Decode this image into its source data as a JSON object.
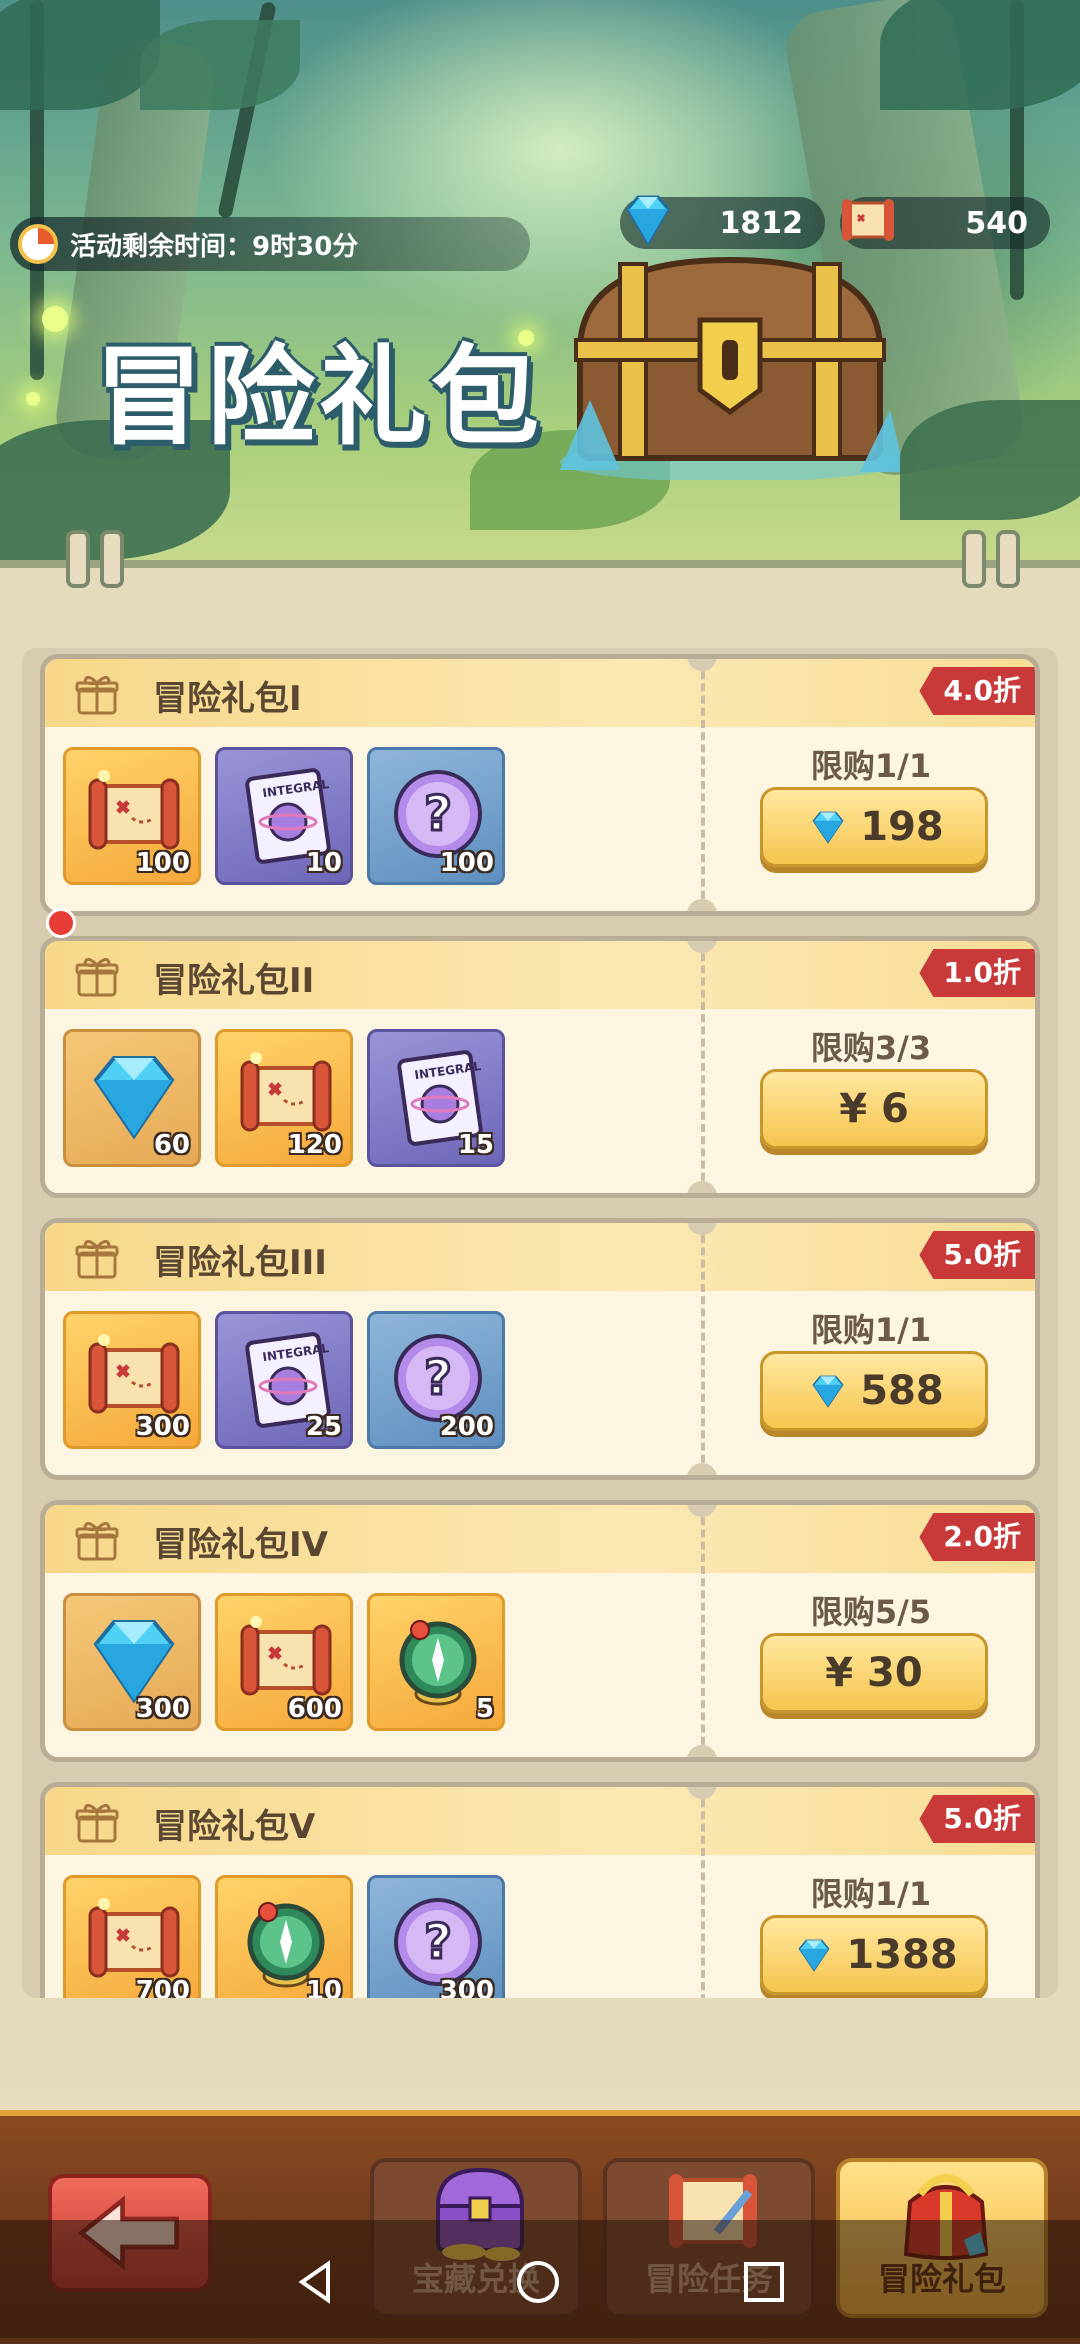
{
  "header": {
    "timer_label": "活动剩余时间：",
    "timer_value": "9时30分",
    "diamonds": "1812",
    "scrolls": "540",
    "title": "冒险礼包"
  },
  "packs": [
    {
      "title": "冒险礼包I",
      "discount": "4.0折",
      "limit": "限购1/1",
      "price": "198",
      "price_type": "diamond",
      "items": [
        {
          "icon": "map-scroll-icon",
          "qty": "100",
          "bg": "orange"
        },
        {
          "icon": "integral-ticket-icon",
          "qty": "10",
          "bg": "purple"
        },
        {
          "icon": "mystery-orb-icon",
          "qty": "100",
          "bg": "blue"
        }
      ]
    },
    {
      "title": "冒险礼包II",
      "discount": "1.0折",
      "limit": "限购3/3",
      "price": "¥ 6",
      "price_type": "cash",
      "items": [
        {
          "icon": "diamond-icon",
          "qty": "60",
          "bg": "tan"
        },
        {
          "icon": "map-scroll-icon",
          "qty": "120",
          "bg": "orange"
        },
        {
          "icon": "integral-ticket-icon",
          "qty": "15",
          "bg": "purple"
        }
      ]
    },
    {
      "title": "冒险礼包III",
      "discount": "5.0折",
      "limit": "限购1/1",
      "price": "588",
      "price_type": "diamond",
      "items": [
        {
          "icon": "map-scroll-icon",
          "qty": "300",
          "bg": "orange"
        },
        {
          "icon": "integral-ticket-icon",
          "qty": "25",
          "bg": "purple"
        },
        {
          "icon": "mystery-orb-icon",
          "qty": "200",
          "bg": "blue"
        }
      ]
    },
    {
      "title": "冒险礼包IV",
      "discount": "2.0折",
      "limit": "限购5/5",
      "price": "¥ 30",
      "price_type": "cash",
      "items": [
        {
          "icon": "diamond-icon",
          "qty": "300",
          "bg": "tan"
        },
        {
          "icon": "map-scroll-icon",
          "qty": "600",
          "bg": "orange"
        },
        {
          "icon": "compass-icon",
          "qty": "5",
          "bg": "orange"
        }
      ]
    },
    {
      "title": "冒险礼包V",
      "discount": "5.0折",
      "limit": "限购1/1",
      "price": "1388",
      "price_type": "diamond",
      "items": [
        {
          "icon": "map-scroll-icon",
          "qty": "700",
          "bg": "orange"
        },
        {
          "icon": "compass-icon",
          "qty": "10",
          "bg": "orange"
        },
        {
          "icon": "mystery-orb-icon",
          "qty": "300",
          "bg": "blue"
        }
      ]
    }
  ],
  "tabs": [
    {
      "label": "宝藏兑换",
      "icon": "treasure-chest-icon",
      "active": false
    },
    {
      "label": "冒险任务",
      "icon": "quest-scroll-icon",
      "active": false
    },
    {
      "label": "冒险礼包",
      "icon": "gift-bag-icon",
      "active": true
    }
  ],
  "colors": {
    "discount": "#c8393a",
    "accent": "#f6c54e",
    "panel": "#fbf5e2"
  }
}
